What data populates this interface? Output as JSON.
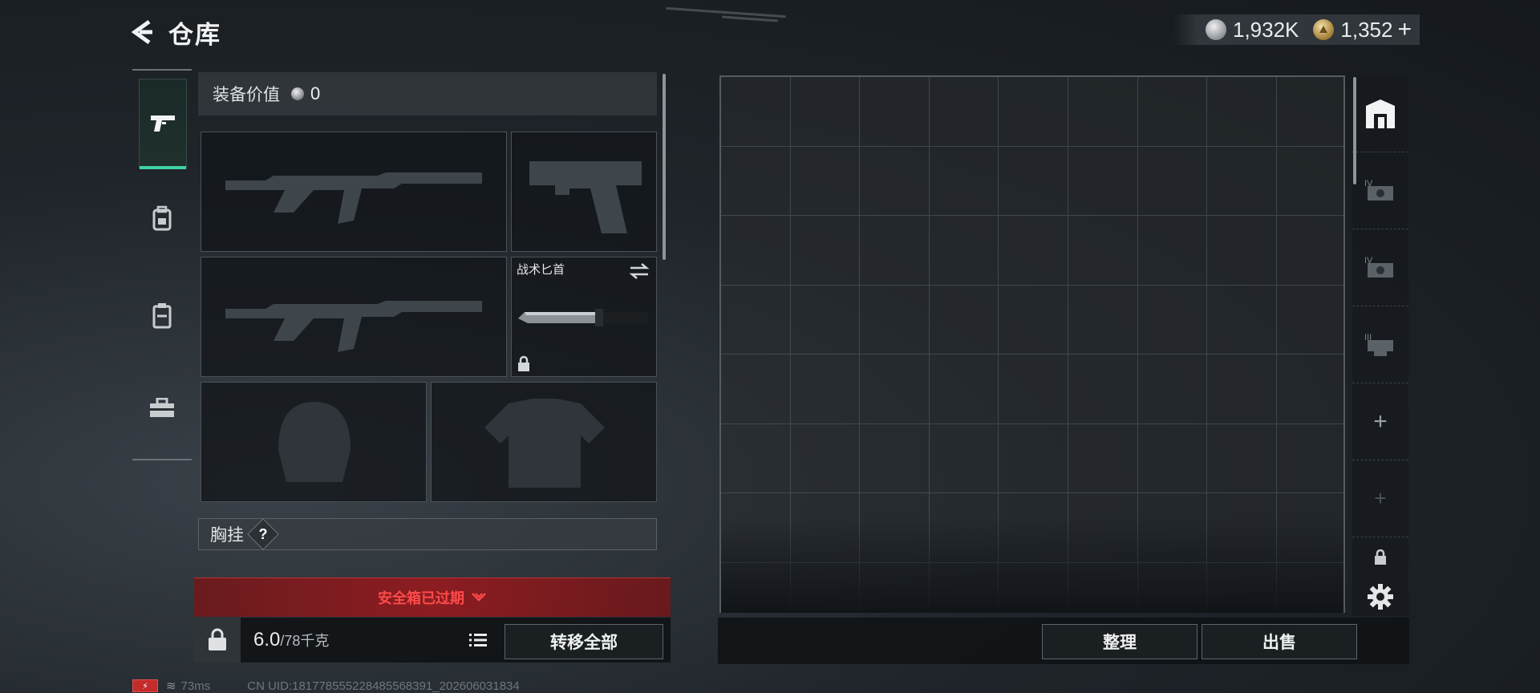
{
  "header": {
    "title": "仓库"
  },
  "currency": {
    "silver": "1,932K",
    "gold": "1,352",
    "plus": "+"
  },
  "categories": [
    {
      "icon": "pistol-icon",
      "active": true
    },
    {
      "icon": "backpack-icon",
      "active": false
    },
    {
      "icon": "chest-rig-icon",
      "active": false
    },
    {
      "icon": "toolbox-icon",
      "active": false
    }
  ],
  "equipment": {
    "value_label": "装备价值",
    "value": "0",
    "knife_slot_label": "战术匕首",
    "chest_rig_label": "胸挂",
    "chest_rig_help": "?"
  },
  "safebox": {
    "expired_text": "安全箱已过期"
  },
  "inventory": {
    "weight_current": "6.0",
    "weight_max": "/78千克",
    "transfer_all": "转移全部"
  },
  "storage": {
    "organize": "整理",
    "sell": "出售"
  },
  "rail": [
    {
      "icon": "stash-icon",
      "label": ""
    },
    {
      "icon": "case-iv-icon",
      "label": "IV"
    },
    {
      "icon": "case-iv-icon",
      "label": "IV"
    },
    {
      "icon": "case-iii-icon",
      "label": "III"
    },
    {
      "icon": "add-icon",
      "label": "+"
    },
    {
      "icon": "add-icon",
      "label": "+"
    },
    {
      "icon": "lock-icon",
      "label": ""
    }
  ],
  "status": {
    "ping": "73ms",
    "uid": "CN UID:181778555228485568391_202606031834"
  },
  "colors": {
    "accent": "#3fd1a2",
    "warning": "#ff4a4a"
  }
}
